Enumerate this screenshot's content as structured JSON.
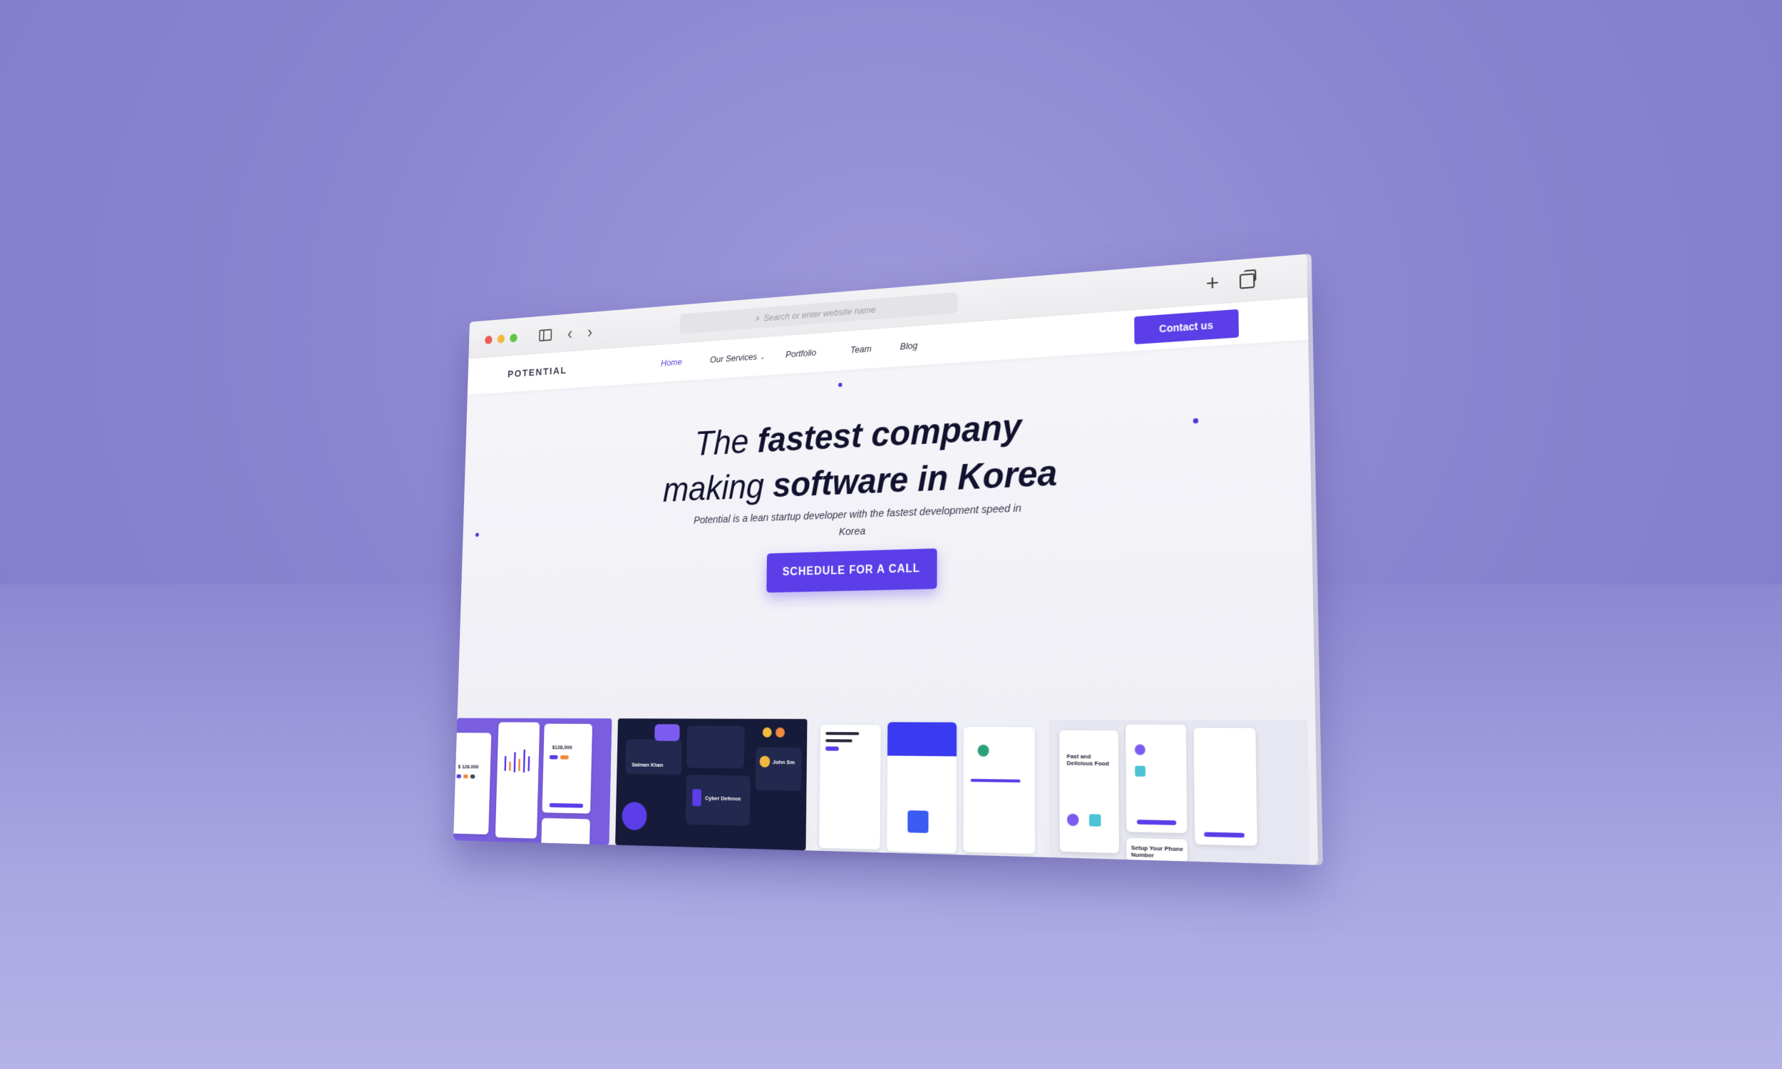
{
  "browser": {
    "address_placeholder": "Search or enter website name",
    "icons": [
      "sidebar-icon",
      "back-icon",
      "forward-icon",
      "plus-icon",
      "tabs-icon"
    ]
  },
  "nav": {
    "logo": "POTENTIAL",
    "items": [
      {
        "label": "Home",
        "active": true
      },
      {
        "label": "Our Services",
        "dropdown": true
      },
      {
        "label": "Portfolio"
      },
      {
        "label": "Team"
      },
      {
        "label": "Blog"
      }
    ],
    "contact_label": "Contact us"
  },
  "hero": {
    "line1_plain": "The",
    "line1_bold": "fastest company",
    "line2_plain": "making",
    "line2_bold": "software in Korea",
    "subtitle": "Potential is a lean startup developer with the fastest development speed in Korea",
    "cta_label": "SCHEDULE FOR A CALL"
  },
  "thumbnails": {
    "finance": {
      "balance_a": "$ 128.000",
      "balance_b": "$128,000"
    },
    "dashboard": {
      "user_a": "Salman Khan",
      "title": "Cyber Defence",
      "user_b": "John Sm"
    },
    "food": {
      "headline": "Fast and Delicious Food",
      "setup": "Setup Your Phone Number"
    }
  },
  "colors": {
    "accent": "#5b3ee8",
    "background": "#8b85d0",
    "text": "#12122e"
  }
}
